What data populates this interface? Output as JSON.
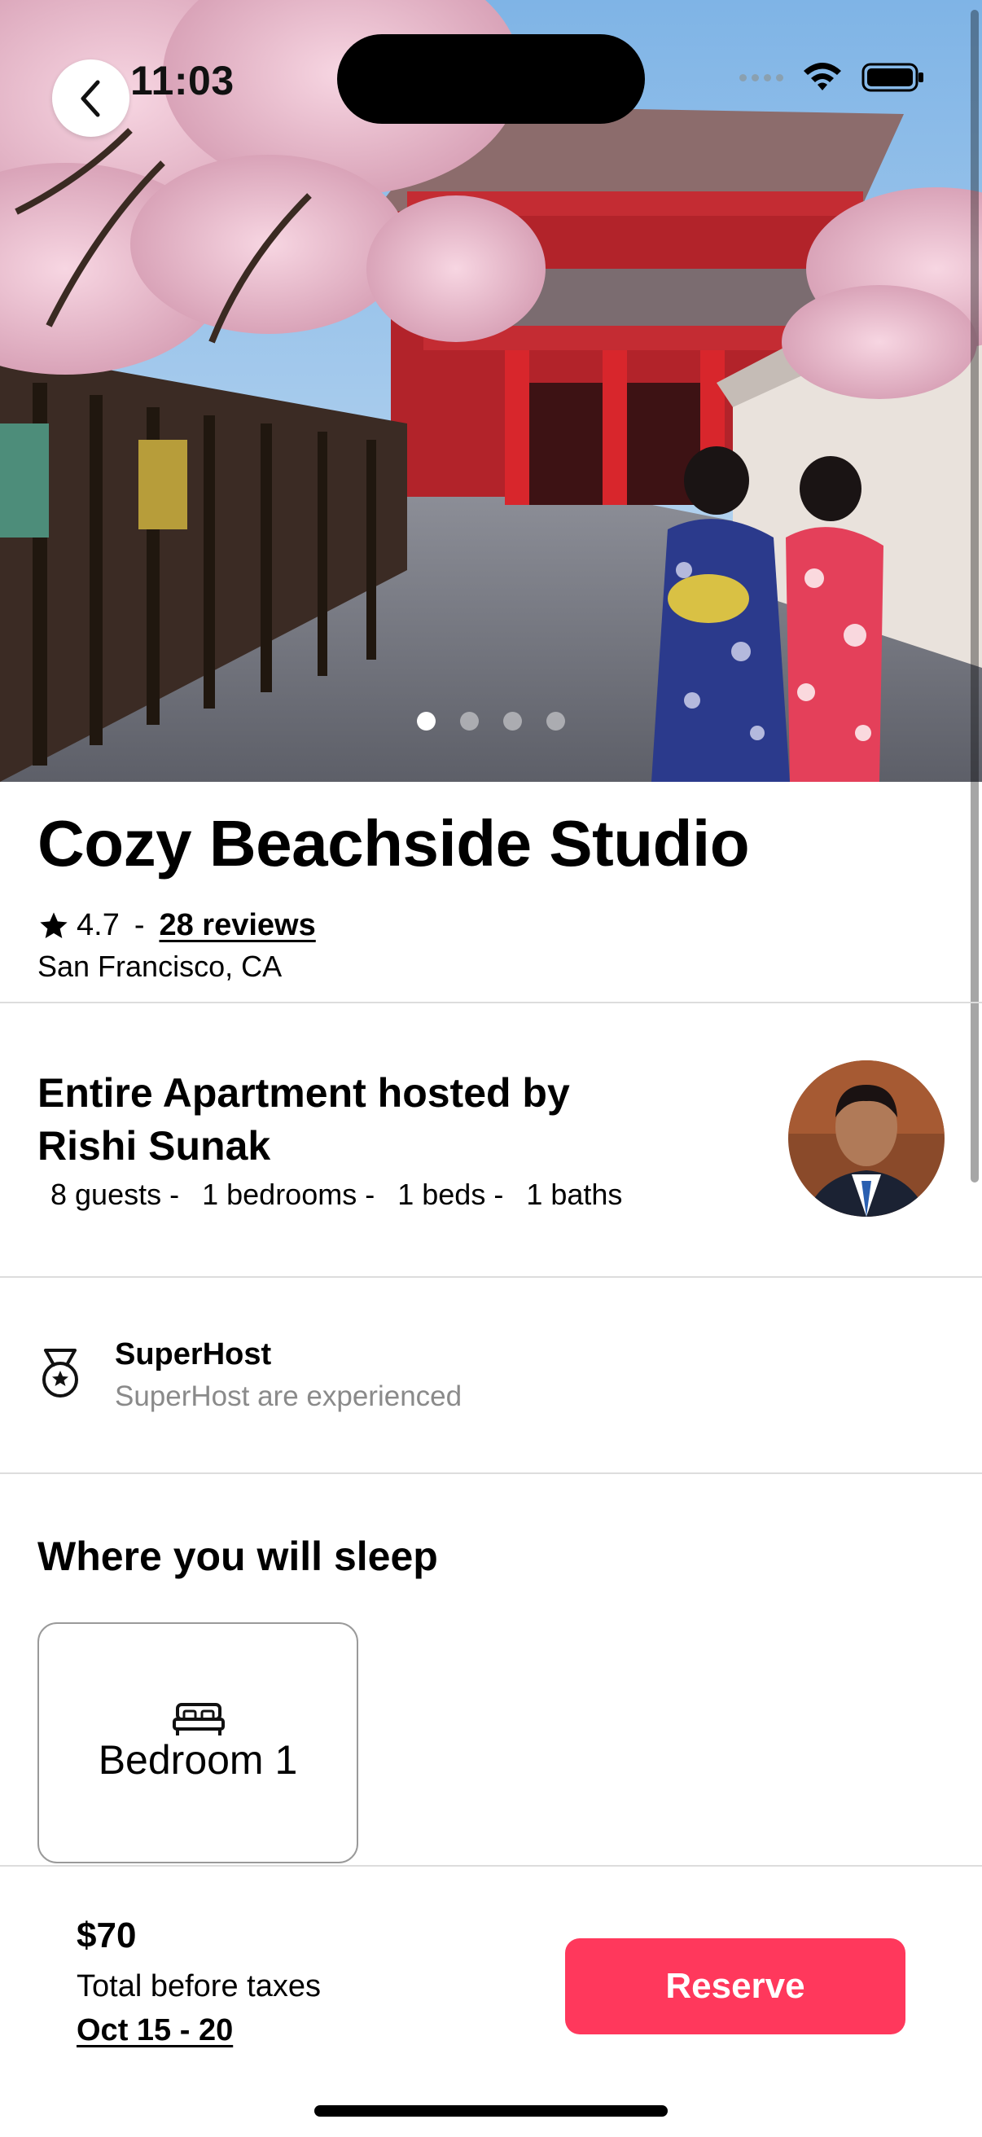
{
  "status_bar": {
    "time": "11:03"
  },
  "gallery": {
    "image_count": 4,
    "active_index": 0
  },
  "listing": {
    "title": "Cozy Beachside Studio",
    "rating": "4.7",
    "rating_separator": "-",
    "reviews_label": "28 reviews",
    "location": "San Francisco, CA"
  },
  "host": {
    "title": "Entire Apartment hosted by Rishi Sunak",
    "stats": [
      "8 guests -",
      "1 bedrooms -",
      "1 beds -",
      "1 baths"
    ]
  },
  "superhost": {
    "title": "SuperHost",
    "subtitle": "SuperHost are experienced"
  },
  "sleep": {
    "heading": "Where you will sleep",
    "rooms": [
      {
        "label": "Bedroom 1"
      }
    ]
  },
  "footer": {
    "price": "$70",
    "total_label": "Total before taxes",
    "dates": "Oct 15 - 20",
    "reserve_label": "Reserve"
  },
  "colors": {
    "accent": "#ff385c"
  },
  "icons": [
    "chevron-left-icon",
    "wifi-icon",
    "battery-icon",
    "star-icon",
    "medal-icon",
    "bed-icon"
  ]
}
